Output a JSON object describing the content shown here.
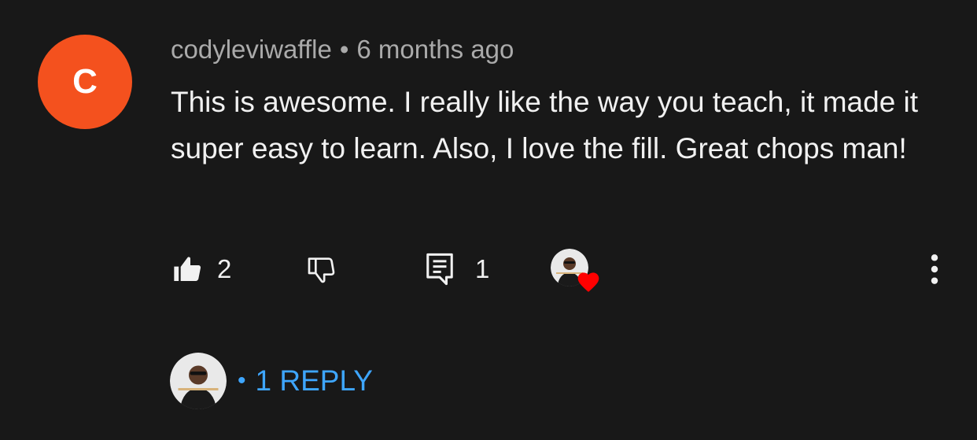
{
  "comment": {
    "author_initial": "C",
    "author": "codyleviwaffle",
    "separator": "•",
    "time": "6 months ago",
    "text": "This is awesome. I really like the way you teach, it made it super easy to learn. Also, I love the fill. Great chops man!",
    "avatar_color": "#f4511e"
  },
  "actions": {
    "like_icon": "thumbs-up-icon",
    "like_count": "2",
    "dislike_icon": "thumbs-down-icon",
    "reply_icon": "comment-icon",
    "reply_count": "1",
    "creator_heart_icon": "heart-icon",
    "heart_color": "#ff0000",
    "more_icon": "more-vertical-icon"
  },
  "replies": {
    "separator": "•",
    "label": "1 REPLY",
    "link_color": "#3ea6ff"
  }
}
